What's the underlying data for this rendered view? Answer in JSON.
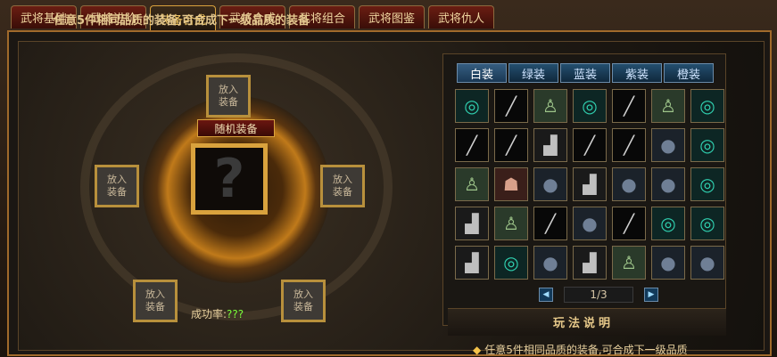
{
  "tabs": [
    {
      "label": "武将基础"
    },
    {
      "label": "武将进阶"
    },
    {
      "label": "装备合成"
    },
    {
      "label": "武将合成"
    },
    {
      "label": "武将组合"
    },
    {
      "label": "武将图鉴"
    },
    {
      "label": "武将仇人"
    }
  ],
  "main": {
    "title": "任意5件相同品质的装备,可合成下一级品质的装备",
    "center_label": "随机装备",
    "center_symbol": "?",
    "slot_label": "放入装备",
    "success_label": "成功率:",
    "success_value": "???"
  },
  "inventory": {
    "tabs": [
      "白装",
      "绿装",
      "蓝装",
      "紫装",
      "橙装"
    ],
    "rows": [
      [
        "ring",
        "sword",
        "armor",
        "ring",
        "sword",
        "armor",
        "ring"
      ],
      [
        "sword",
        "sword",
        "boot",
        "sword",
        "sword",
        "ball",
        "ring"
      ],
      [
        "armor",
        "helm",
        "ball",
        "boot",
        "ball",
        "ball",
        "ring"
      ],
      [
        "boot",
        "armor",
        "sword",
        "ball",
        "sword",
        "ring",
        "ring"
      ],
      [
        "boot",
        "ring",
        "ball",
        "boot",
        "armor",
        "ball",
        "ball"
      ]
    ],
    "page": "1/3"
  },
  "help": {
    "title": "玩法说明",
    "text": "任意5件相同品质的装备,可合成下一级品质"
  },
  "icons": {
    "ring": "ring-icon",
    "sword": "sword-icon",
    "armor": "armor-icon",
    "boot": "boot-icon",
    "ball": "ball-icon",
    "helm": "helmet-icon"
  }
}
